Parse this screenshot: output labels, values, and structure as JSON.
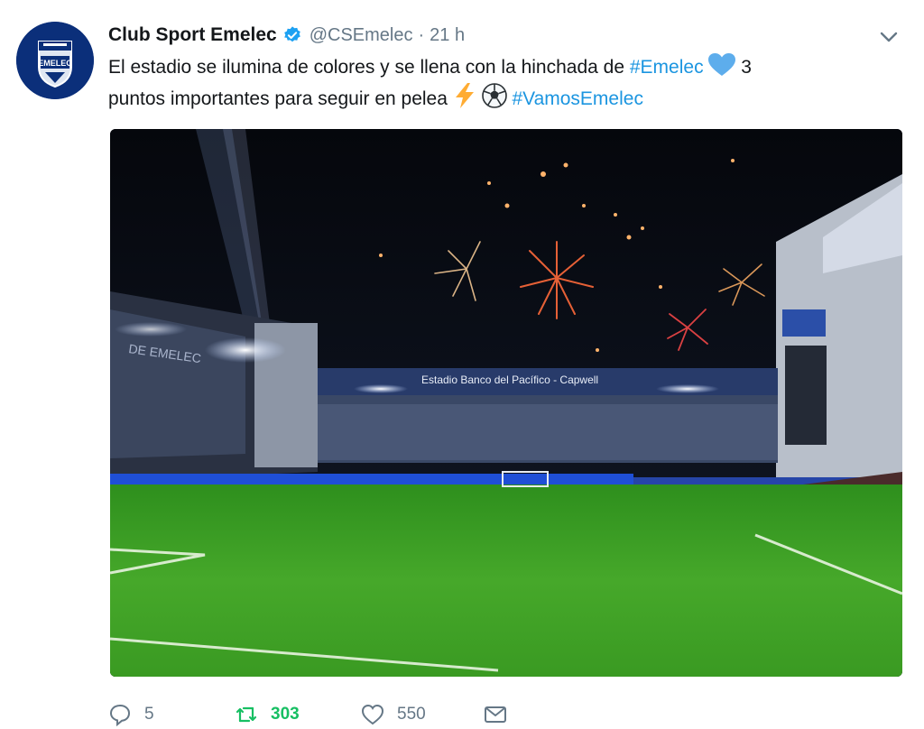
{
  "tweet": {
    "author": {
      "display_name": "Club Sport Emelec",
      "handle": "@CSEmelec",
      "verified": true,
      "avatar_text": "EMELEC"
    },
    "time_separator": "·",
    "time": "21 h",
    "text": {
      "part1": "El estadio se ilumina de colores y se llena con la hinchada de ",
      "hashtag1": "#Emelec",
      "part2": " 3",
      "line2_part1": "puntos importantes para seguir en pelea ",
      "hashtag2": "#VamosEmelec"
    },
    "media": {
      "banner_text": "Estadio Banco del Pacífico - Capwell",
      "stand_text": "DE EMELEC"
    },
    "actions": {
      "replies": "5",
      "retweets": "303",
      "likes": "550"
    }
  },
  "colors": {
    "hashtag": "#1b95e0",
    "retweet_active": "#17bf63",
    "muted": "#657786",
    "verified": "#1da1f2",
    "heart_emoji": "#5dadec"
  },
  "icons": [
    "verified-badge-icon",
    "chevron-down-icon",
    "blue-heart-emoji-icon",
    "lightning-emoji-icon",
    "soccer-ball-emoji-icon",
    "reply-icon",
    "retweet-icon",
    "like-icon",
    "direct-message-icon"
  ]
}
